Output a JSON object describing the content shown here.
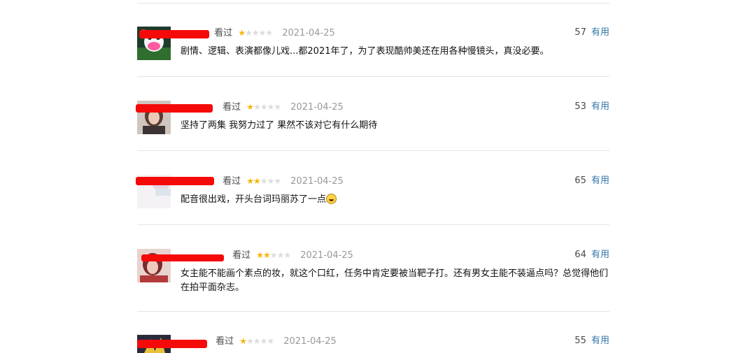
{
  "comments": [
    {
      "username": "",
      "status": "看过",
      "rating": 1,
      "date": "2021-04-25",
      "votes": "57",
      "useful_label": "有用",
      "content": "剧情、逻辑、表演都像儿戏...都2021年了，为了表现酷帅美还在用各种慢镜头，真没必要。"
    },
    {
      "username": "",
      "status": "看过",
      "rating": 1,
      "date": "2021-04-25",
      "votes": "53",
      "useful_label": "有用",
      "content": "坚持了两集 我努力过了 果然不该对它有什么期待"
    },
    {
      "username": "",
      "status": "看过",
      "rating": 2,
      "date": "2021-04-25",
      "votes": "65",
      "useful_label": "有用",
      "content": "配音很出戏，开头台词玛丽苏了一点"
    },
    {
      "username": "",
      "status": "看过",
      "rating": 2,
      "date": "2021-04-25",
      "votes": "64",
      "useful_label": "有用",
      "content": "女主能不能画个素点的妆，就这个口红，任务中肯定要被当靶子打。还有男女主能不装逼点吗？总觉得他们在拍平面杂志。"
    },
    {
      "username": "",
      "status": "看过",
      "rating": 1,
      "date": "2021-04-25",
      "votes": "55",
      "useful_label": "有用",
      "content": ""
    }
  ],
  "colors": {
    "link": "#3377aa",
    "star_on": "#f7b500",
    "star_off": "#dcdcdc",
    "redaction": "#f50a0a"
  }
}
